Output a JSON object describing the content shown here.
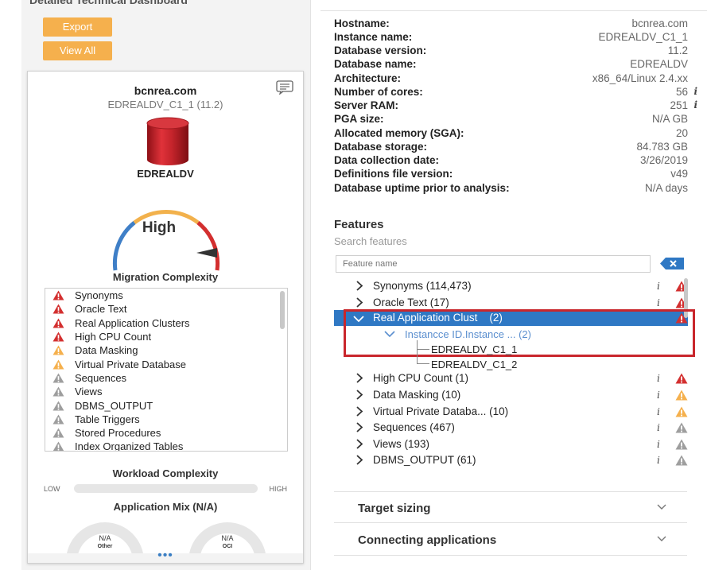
{
  "left": {
    "title": "Detailed Technical Dashboard",
    "export_label": "Export",
    "viewall_label": "View All",
    "card": {
      "hostname": "bcnrea.com",
      "instance": "EDREALDV_C1_1 (11.2)",
      "db_name": "EDREALDV",
      "gauge_label": "High",
      "migration_title": "Migration Complexity",
      "migration_items": [
        {
          "label": "Synonyms",
          "severity": "high"
        },
        {
          "label": "Oracle Text",
          "severity": "high"
        },
        {
          "label": "Real Application Clusters",
          "severity": "high"
        },
        {
          "label": "High CPU Count",
          "severity": "high"
        },
        {
          "label": "Data Masking",
          "severity": "medium"
        },
        {
          "label": "Virtual Private Database",
          "severity": "medium"
        },
        {
          "label": "Sequences",
          "severity": "low"
        },
        {
          "label": "Views",
          "severity": "low"
        },
        {
          "label": "DBMS_OUTPUT",
          "severity": "low"
        },
        {
          "label": "Table Triggers",
          "severity": "low"
        },
        {
          "label": "Stored Procedures",
          "severity": "low"
        },
        {
          "label": "Index Organized Tables",
          "severity": "low"
        }
      ],
      "workload_title": "Workload Complexity",
      "workload_low": "LOW",
      "workload_high": "HIGH",
      "appmix_title": "Application Mix (N/A)",
      "donut_other_value": "N/A",
      "donut_other_label": "Other",
      "donut_oci_value": "N/A",
      "donut_oci_label": "OCI",
      "more": "•••"
    }
  },
  "info": [
    {
      "label": "Hostname:",
      "value": "bcnrea.com",
      "info": false
    },
    {
      "label": "Instance name:",
      "value": "EDREALDV_C1_1",
      "info": false
    },
    {
      "label": "Database version:",
      "value": "11.2",
      "info": false
    },
    {
      "label": "Database name:",
      "value": "EDREALDV",
      "info": false
    },
    {
      "label": "Architecture:",
      "value": "x86_64/Linux 2.4.xx",
      "info": false
    },
    {
      "label": "Number of cores:",
      "value": "56",
      "info": true
    },
    {
      "label": "Server RAM:",
      "value": "251",
      "info": true
    },
    {
      "label": "PGA size:",
      "value": "N/A GB",
      "info": false
    },
    {
      "label": "Allocated memory (SGA):",
      "value": "20",
      "info": false
    },
    {
      "label": "Database storage:",
      "value": "84.783 GB",
      "info": false
    },
    {
      "label": "Data collection date:",
      "value": "3/26/2019",
      "info": false
    },
    {
      "label": "Definitions file version:",
      "value": "v49",
      "info": false
    },
    {
      "label": "Database uptime prior to analysis:",
      "value": "N/A days",
      "info": false
    }
  ],
  "features": {
    "title": "Features",
    "subtitle": "Search features",
    "placeholder": "Feature name",
    "tree": [
      {
        "label": "Synonyms (114,473)",
        "severity": "high",
        "expanded": false
      },
      {
        "label": "Oracle Text (17)",
        "severity": "high",
        "expanded": false
      },
      {
        "label": "Real Application Clust    (2)",
        "severity": "high",
        "expanded": true,
        "selected": true
      },
      {
        "label": "High CPU Count (1)",
        "severity": "high",
        "expanded": false
      },
      {
        "label": "Data Masking (10)",
        "severity": "medium",
        "expanded": false
      },
      {
        "label": "Virtual Private Databa... (10)",
        "severity": "medium",
        "expanded": false
      },
      {
        "label": "Sequences (467)",
        "severity": "low",
        "expanded": false
      },
      {
        "label": "Views (193)",
        "severity": "low",
        "expanded": false
      },
      {
        "label": "DBMS_OUTPUT (61)",
        "severity": "low",
        "expanded": false
      }
    ],
    "rac_children": {
      "instance_label": "Instancce ID.Instance ... (2)",
      "leaves": [
        "EDREALDV_C1_1",
        "EDREALDV_C1_2"
      ]
    }
  },
  "accordions": {
    "target_sizing": "Target sizing",
    "connecting_apps": "Connecting applications"
  },
  "colors": {
    "accent_blue": "#2f78c4",
    "orange": "#f5b04d",
    "severity_high": "#d32f2f",
    "severity_medium": "#f5b04d",
    "severity_low": "#9e9e9e",
    "highlight_box": "#c9262c"
  }
}
